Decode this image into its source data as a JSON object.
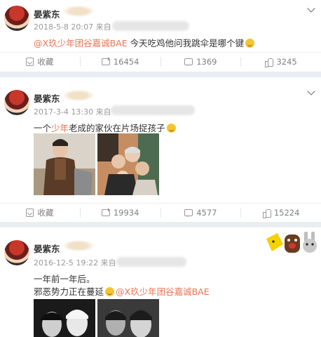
{
  "posts": [
    {
      "user": "晏紫东",
      "date": "2018-5-8 20:07",
      "source_prefix": "来自",
      "mention": "@X玖少年团谷嘉诚BAE",
      "text": "今天吃鸡他问我跳伞是哪个键",
      "actions": {
        "favorite": "收藏",
        "repost": "16454",
        "comment": "1369",
        "like": "3245"
      }
    },
    {
      "user": "晏紫东",
      "date": "2017-3-4 13:30",
      "source_prefix": "来自",
      "text_a": "一个",
      "text_highlight": "少年",
      "text_b": "老成的家伙在片场捉孩子",
      "actions": {
        "favorite": "收藏",
        "repost": "19934",
        "comment": "4577",
        "like": "15224"
      }
    },
    {
      "user": "晏紫东",
      "date": "2016-12-5 19:22",
      "source_prefix": "来自",
      "line1": "一年前一年后。",
      "line2": "邪恶势力正在蔓延",
      "mention": "@X玖少年团谷嘉诚BAE"
    }
  ],
  "colors": {
    "accent": "#eb7350",
    "meta": "#999999",
    "divider": "#e9eef3"
  },
  "icons": [
    "chevron-down-icon",
    "favorite-icon",
    "repost-icon",
    "comment-icon",
    "like-icon",
    "grin-emoji-icon"
  ]
}
